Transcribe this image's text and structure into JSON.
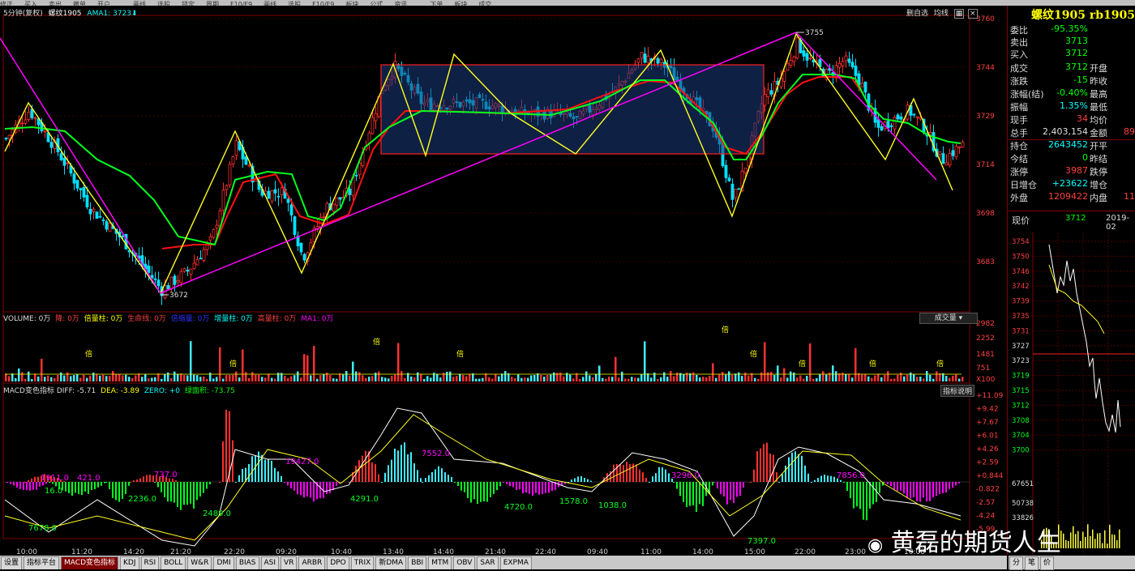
{
  "toolbar": {
    "items": [
      "修正",
      "买入",
      "卖出",
      "撤单",
      "开户",
      "",
      "画线",
      "选股",
      "锁定",
      "周期",
      "F10/F9",
      "画线",
      "选股",
      "F10/F9",
      "板块",
      "公式",
      "资讯",
      "",
      "下单",
      "板块",
      "成交",
      "",
      "",
      "",
      "",
      "",
      "",
      ""
    ]
  },
  "chart_head": {
    "period": "5分钟(复权)",
    "symbol": "螺纹1905",
    "ma_label": "AMA1: 3723"
  },
  "chart_head_right": {
    "items": [
      "删自选",
      "均线"
    ]
  },
  "quote": {
    "title": "螺纹1905 rb1905",
    "rows": [
      {
        "l": "委比",
        "v": "-95.35%",
        "c": "#00ff00"
      },
      {
        "l": "卖出",
        "v": "3713",
        "c": "#00ff00"
      },
      {
        "l": "买入",
        "v": "3712",
        "c": "#00ff00"
      },
      {
        "l": "成交",
        "v": "3712",
        "c": "#00ff00",
        "l2": "开盘",
        "v2": ""
      },
      {
        "l": "涨跌",
        "v": "-15",
        "c": "#00ff00",
        "l2": "昨收",
        "v2": ""
      },
      {
        "l": "涨幅(结)",
        "v": "-0.40%",
        "c": "#00ff00",
        "l2": "最高",
        "v2": ""
      },
      {
        "l": "振幅",
        "v": "1.35%",
        "c": "#00ffff",
        "l2": "最低",
        "v2": ""
      },
      {
        "l": "现手",
        "v": "34",
        "c": "#ff4040",
        "l2": "均价",
        "v2": ""
      },
      {
        "l": "总手",
        "v": "2,403,154",
        "c": "#ddd",
        "l2": "金额",
        "v2": "89"
      },
      {
        "l": "持仓",
        "v": "2643452",
        "c": "#00ffff",
        "l2": "开平",
        "v2": ""
      },
      {
        "l": "今结",
        "v": "0",
        "c": "#00ff00",
        "l2": "昨结",
        "v2": ""
      },
      {
        "l": "涨停",
        "v": "3987",
        "c": "#ff4040",
        "l2": "跌停",
        "v2": ""
      },
      {
        "l": "日增仓",
        "v": "+23622",
        "c": "#00ffff",
        "l2": "增仓",
        "v2": ""
      },
      {
        "l": "外盘",
        "v": "1209422",
        "c": "#ff4040",
        "l2": "内盘",
        "v2": "11!"
      }
    ],
    "now_label": "现价",
    "now_value": "3712",
    "date": "2019-02"
  },
  "mini_chart": {
    "price_ticks": [
      "3754",
      "3750",
      "3746",
      "3742",
      "3739",
      "3735",
      "3731",
      "3727",
      "3723",
      "3719",
      "3715",
      "3712",
      "3708",
      "3704",
      "3700"
    ],
    "vol_ticks": [
      "67651",
      "50738",
      "33826"
    ]
  },
  "main_chart": {
    "price_axis": [
      "3760",
      "3744",
      "3729",
      "3714",
      "3698",
      "3683"
    ],
    "high_label": "3755",
    "low_label": "3672",
    "time_axis": [
      "10:00",
      "11:20",
      "14:20",
      "21:20",
      "22:20",
      "09:20",
      "10:40",
      "13:40",
      "14:40",
      "21:40",
      "22:40",
      "09:40",
      "11:00",
      "14:00",
      "15:00",
      "22:00",
      "23:00",
      "10:00"
    ]
  },
  "volume": {
    "head": [
      "VOLUME: 0万",
      "降: 0万",
      "倍量柱: 0万",
      "生命线: 0万",
      "倍缩量: 0万",
      "增量柱: 0万",
      "高量柱: 0万",
      "MA1: 0万"
    ],
    "button": "成交量",
    "axis": [
      "2982",
      "2252",
      "1481",
      "751",
      "X100"
    ]
  },
  "macd": {
    "head": [
      "MACD变色指标 DIFF: -5.71",
      "DEA: -3.89",
      "ZERO: +0",
      "绿面积: -73.75"
    ],
    "button": "指标说明",
    "axis": [
      "+11.09",
      "+9.42",
      "+7.67",
      "+6.01",
      "+4.26",
      "+2.59",
      "+0.844",
      "-0.822",
      "-2.57",
      "-4.24",
      "-5.99"
    ],
    "labels": [
      "1911.0",
      "421.0",
      "737.0",
      "16.0",
      "2236.0",
      "7678.0",
      "2489.0",
      "19427.0",
      "4291.0",
      "7552.0",
      "4720.0",
      "1578.0",
      "1038.0",
      "3296.0",
      "7397.0",
      "7856.0"
    ]
  },
  "bottom_tabs": [
    "设置",
    "指标平台",
    "MACD变色指标",
    "KDJ",
    "RSI",
    "BOLL",
    "W&R",
    "DMI",
    "BIAS",
    "ASI",
    "VR",
    "ARBR",
    "DPO",
    "TRIX",
    "新DMA",
    "BBI",
    "MTM",
    "OBV",
    "SAR",
    "EXPMA"
  ],
  "right_tabs": [
    "分",
    "笔",
    "价"
  ],
  "watermark": "黄磊的期货人生"
}
